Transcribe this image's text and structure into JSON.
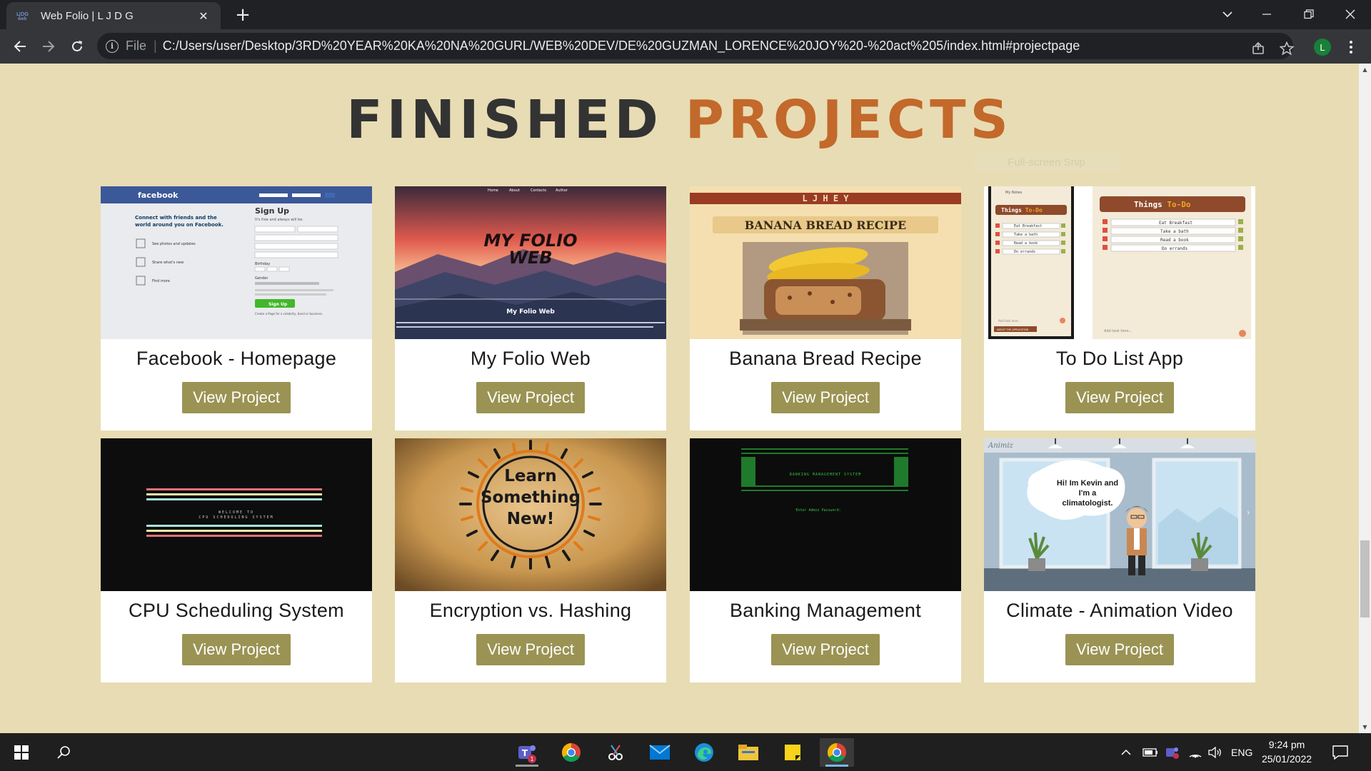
{
  "browser": {
    "tab": {
      "title": "Web Folio | L J D G",
      "favicon": "ljdg-favicon-icon",
      "close_icon": "close-icon"
    },
    "new_tab_icon": "plus-icon",
    "window_controls": [
      "tab-search-icon",
      "minimize-icon",
      "restore-icon",
      "close-icon"
    ],
    "nav": [
      "back-icon",
      "forward-icon",
      "reload-icon"
    ],
    "address_bar": {
      "scheme_label": "File",
      "separator": "|",
      "url": "C:/Users/user/Desktop/3RD%20YEAR%20KA%20NA%20GURL/WEB%20DEV/DE%20GUZMAN_LORENCE%20JOY%20-%20act%205/index.html#projectpage"
    },
    "profile_initial": "L",
    "accent": "#188038"
  },
  "page": {
    "heading": {
      "word1": "FINISHED",
      "word2": "PROJECTS"
    },
    "snip_overlay": "Full-screen Snip",
    "colors": {
      "background": "#e8dcb4",
      "heading_dark": "#333333",
      "heading_accent": "#c2692b",
      "button": "#9a9353"
    },
    "projects": [
      {
        "title": "Facebook - Homepage",
        "button": "View Project"
      },
      {
        "title": "My Folio Web",
        "button": "View Project"
      },
      {
        "title": "Banana Bread Recipe",
        "button": "View Project"
      },
      {
        "title": "To Do List App",
        "button": "View Project"
      },
      {
        "title": "CPU Scheduling System",
        "button": "View Project"
      },
      {
        "title": "Encryption vs. Hashing",
        "button": "View Project"
      },
      {
        "title": "Banking Management",
        "button": "View Project"
      },
      {
        "title": "Climate - Animation Video",
        "button": "View Project"
      }
    ],
    "thumbs": {
      "facebook": {
        "brand": "facebook",
        "tagline": "Connect with friends and the world around you on Facebook.",
        "signup_title": "Sign Up",
        "signup_sub": "It's free and always will be.",
        "signup_button": "Sign Up",
        "features": [
          "See photos and updates",
          "Share what's new",
          "Find more"
        ],
        "fields": [
          "First name",
          "Last name",
          "Email or mobile number",
          "Re-enter email or mobile number",
          "New password"
        ],
        "birthday_label": "Birthday",
        "gender_label": "Gender",
        "page_link": "Create a Page for a celebrity, band or business."
      },
      "folio": {
        "nav": [
          "Home",
          "About",
          "Contacts",
          "Author"
        ],
        "logo_line1": "MY FOLIO",
        "logo_line2": "WEB",
        "subtitle": "My Folio Web"
      },
      "banana": {
        "brand": "L J H E Y",
        "banner": "BANANA BREAD RECIPE"
      },
      "todo": {
        "sidebar_label": "My Notes",
        "title_a": "Things",
        "title_b": "To-Do",
        "items": [
          "Eat Breakfast",
          "Take a bath",
          "Read a book",
          "Do errands"
        ],
        "add_placeholder": "Add task here...",
        "about_label": "ABOUT THE APPLICATION"
      },
      "cpu": {
        "line1": "WELCOME TO",
        "line2": "CPU SCHEDULING SYSTEM"
      },
      "encryption": {
        "line1": "Learn",
        "line2": "Something",
        "line3": "New!"
      },
      "banking": {
        "title": "BANKING MANAGEMENT SYSTEM",
        "prompt": "Enter Admin Password:"
      },
      "climate": {
        "watermark": "Animiz",
        "bubble": "Hi! Im Kevin and I'm a climatologist."
      }
    }
  },
  "taskbar": {
    "apps": [
      "windows-start-icon",
      "search-icon",
      "teams-icon",
      "chrome-icon",
      "snipping-tool-icon",
      "mail-icon",
      "edge-icon",
      "file-explorer-icon",
      "sticky-notes-icon",
      "chrome-icon"
    ],
    "teams_badge": "1",
    "tray_icons": [
      "chevron-up-icon",
      "battery-icon",
      "teams-tray-icon",
      "wifi-icon",
      "volume-icon"
    ],
    "language": "ENG",
    "time": "9:24 pm",
    "date": "25/01/2022",
    "notification_icon": "notification-icon"
  }
}
